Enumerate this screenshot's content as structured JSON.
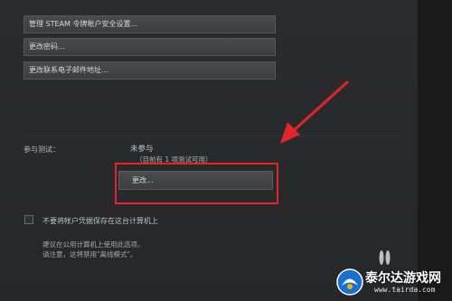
{
  "account": {
    "buttons": {
      "manage_guard": "管理 STEAM 令牌帐户安全设置...",
      "change_password": "更改密码...",
      "change_email": "更改联系电子邮件地址..."
    }
  },
  "beta": {
    "label": "参与测试：",
    "status": "未参与",
    "available": "（目前有 1 项测试可用）",
    "change_button": "更改..."
  },
  "remember": {
    "checked": false,
    "label": "不要将帐户凭据保存在这台计算机上",
    "hint_line1": "建议在公用计算机上使用此选项。",
    "hint_line2": "请注意，这将禁用\"离线模式\"。"
  },
  "annotation": {
    "color": "#e0262b"
  },
  "watermark": {
    "name": "泰尔达游戏网",
    "url": "www.tairda.com"
  }
}
